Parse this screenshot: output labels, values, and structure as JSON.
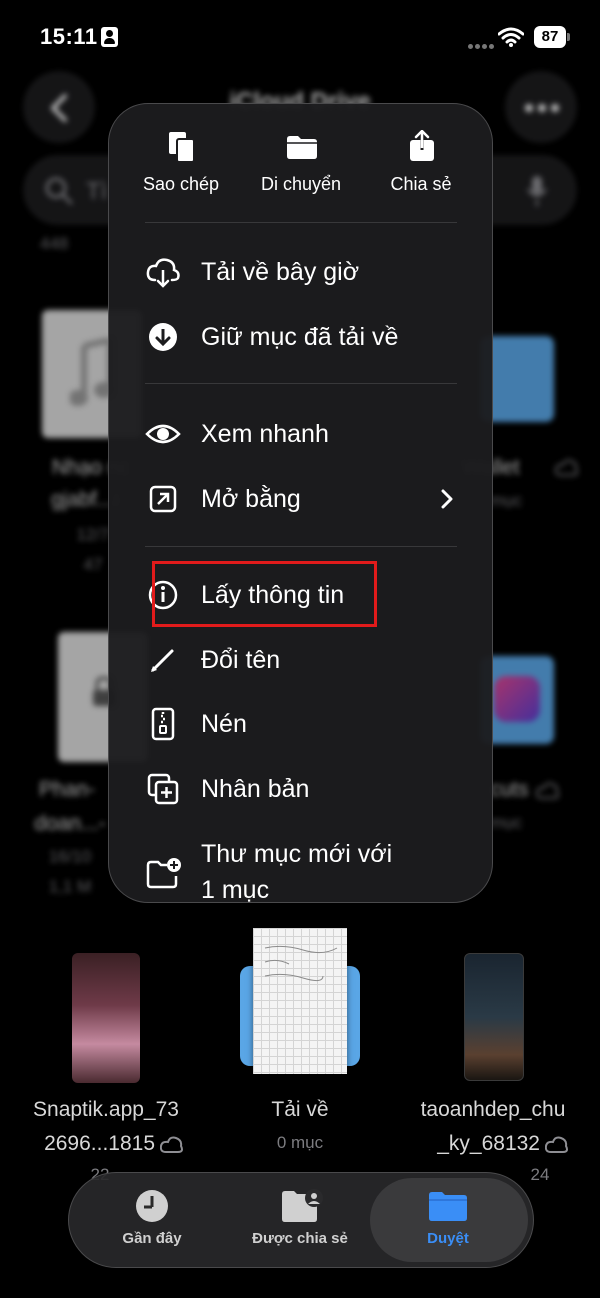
{
  "status_bar": {
    "time": "15:11",
    "battery": "87"
  },
  "nav": {
    "title": "iCloud Drive",
    "search_placeholder": "Tì"
  },
  "background": {
    "count_label": "448",
    "tiles": [
      {
        "label_line1": "Nhạo nc",
        "label_line2": "gjabf...i",
        "sub1": "12/7",
        "sub2": "47"
      },
      {
        "label_line1": "Wallet",
        "sub1": "mục"
      },
      {
        "label_line1": "Phan-",
        "label_line2": "doan...-",
        "sub1": "16/10",
        "sub2": "1,1 M"
      },
      {
        "label_line1": "cuts",
        "sub1": "mục"
      },
      {
        "label_line1": "Snaptik.app_73",
        "label_line2": "2696...1815",
        "sub1": "22"
      },
      {
        "label_line1": "Tải về",
        "sub1": "0 mục"
      },
      {
        "label_line1": "taoanhdep_chu",
        "label_line2": "_ky_68132",
        "sub1": "24"
      }
    ]
  },
  "menu": {
    "top_actions": [
      {
        "label": "Sao chép",
        "icon": "copy-icon"
      },
      {
        "label": "Di chuyển",
        "icon": "folder-icon"
      },
      {
        "label": "Chia sẻ",
        "icon": "share-icon"
      }
    ],
    "items": [
      {
        "label": "Tải về bây giờ",
        "icon": "cloud-download-icon"
      },
      {
        "label": "Giữ mục đã tải về",
        "icon": "arrow-down-circle-icon"
      },
      {
        "label": "Xem nhanh",
        "icon": "eye-icon"
      },
      {
        "label": "Mở bằng",
        "icon": "open-external-icon",
        "chevron": true
      },
      {
        "label": "Lấy thông tin",
        "icon": "info-icon",
        "highlighted": true
      },
      {
        "label": "Đổi tên",
        "icon": "pencil-icon"
      },
      {
        "label": "Nén",
        "icon": "zip-icon"
      },
      {
        "label": "Nhân bản",
        "icon": "duplicate-icon"
      },
      {
        "label_line1": "Thư mục mới với",
        "label_line2": "1 mục",
        "icon": "new-folder-icon"
      }
    ]
  },
  "tabbar": {
    "tabs": [
      {
        "label": "Gần đây",
        "icon": "clock-icon"
      },
      {
        "label": "Được chia sẻ",
        "icon": "shared-folder-icon"
      },
      {
        "label": "Duyệt",
        "icon": "folder-icon",
        "active": true
      }
    ],
    "accent": "#3a8ef6"
  },
  "colors": {
    "highlight_box": "#e21b1b",
    "menu_bg": "#1c1c1e"
  }
}
